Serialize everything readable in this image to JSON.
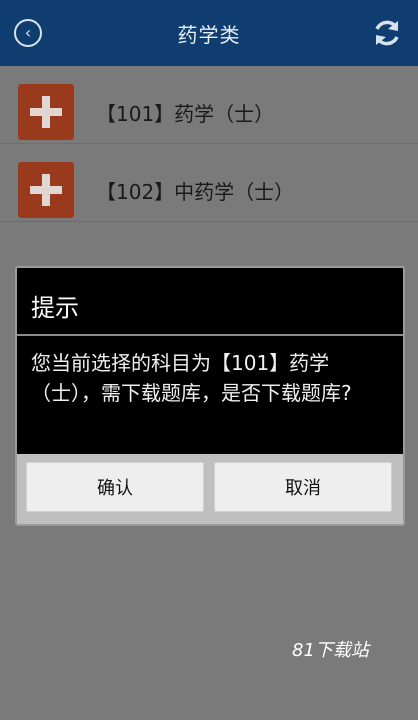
{
  "header": {
    "title": "药学类"
  },
  "list": [
    {
      "label": "【101】药学（士）"
    },
    {
      "label": "【102】中药学（士）"
    }
  ],
  "dialog": {
    "title": "提示",
    "message": "您当前选择的科目为【101】药学（士），需下载题库，是否下载题库?",
    "ok_label": "确认",
    "cancel_label": "取消"
  },
  "watermark": "81下载站",
  "colors": {
    "header_bg": "#0f3d6f",
    "add_tile": "#9a3a1d"
  }
}
